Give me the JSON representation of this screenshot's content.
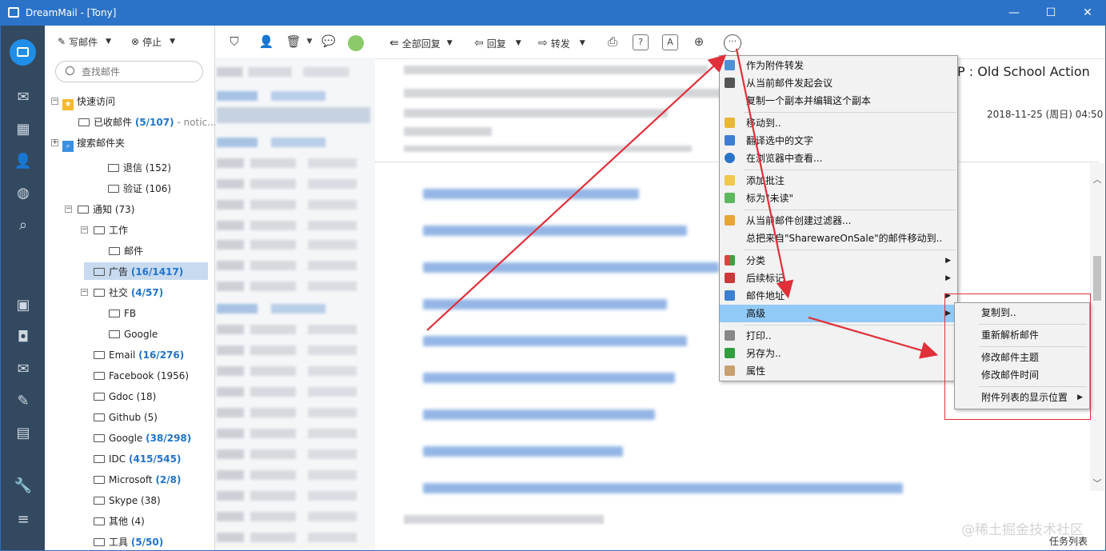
{
  "window": {
    "title": "DreamMail - [Tony]",
    "minimize": "—",
    "maximize": "☐",
    "close": "✕"
  },
  "folder_toolbar": {
    "compose": "写邮件",
    "stop": "停止"
  },
  "search": {
    "placeholder": "查找邮件"
  },
  "tree": {
    "quick_access": "快速访问",
    "received": "已收邮件",
    "received_count": "(5/107)",
    "received_note": "- notic...",
    "search_folders": "搜索邮件夹",
    "bounce": "退信 (152)",
    "verify": "验证 (106)",
    "notice": "通知 (73)",
    "work": "工作",
    "mail": "邮件",
    "ads": "广告",
    "ads_count": "(16/1417)",
    "social": "社交",
    "social_count": "(4/57)",
    "fb": "FB",
    "google_sub": "Google",
    "email": "Email",
    "email_count": "(16/276)",
    "facebook": "Facebook (1956)",
    "gdoc": "Gdoc (18)",
    "github": "Github (5)",
    "google": "Google",
    "google_count": "(38/298)",
    "idc": "IDC",
    "idc_count": "(415/545)",
    "microsoft": "Microsoft",
    "microsoft_count": "(2/8)",
    "skype": "Skype (38)",
    "other": "其他 (4)",
    "tools": "工具",
    "tools_count": "(5/50)"
  },
  "read_toolbar": {
    "reply_all": "全部回复",
    "reply": "回复",
    "forward": "转发"
  },
  "message": {
    "subject": "P : Old School Action",
    "datetime": "2018-11-25 (周日) 04:50"
  },
  "context_menu": {
    "items": [
      "作为附件转发",
      "从当前邮件发起会议",
      "复制一个副本并编辑这个副本",
      "移动到..",
      "翻译选中的文字",
      "在浏览器中查看...",
      "添加批注",
      "标为\"未读\"",
      "从当前邮件创建过滤器...",
      "总把来自\"SharewareOnSale\"的邮件移动到..",
      "分类",
      "后续标记",
      "邮件地址",
      "高级",
      "打印..",
      "另存为..",
      "属性"
    ]
  },
  "submenu": {
    "items": [
      "复制到..",
      "重新解析邮件",
      "修改邮件主题",
      "修改邮件时间",
      "附件列表的显示位置"
    ]
  },
  "statusbar": {
    "task_list": "任务列表"
  },
  "watermark": "@稀土掘金技术社区",
  "colors": {
    "titlebar": "#2b73c8",
    "rail": "#33495f",
    "highlight": "#91c9f7",
    "annotation": "#e0303a",
    "count": "#2274c9"
  }
}
